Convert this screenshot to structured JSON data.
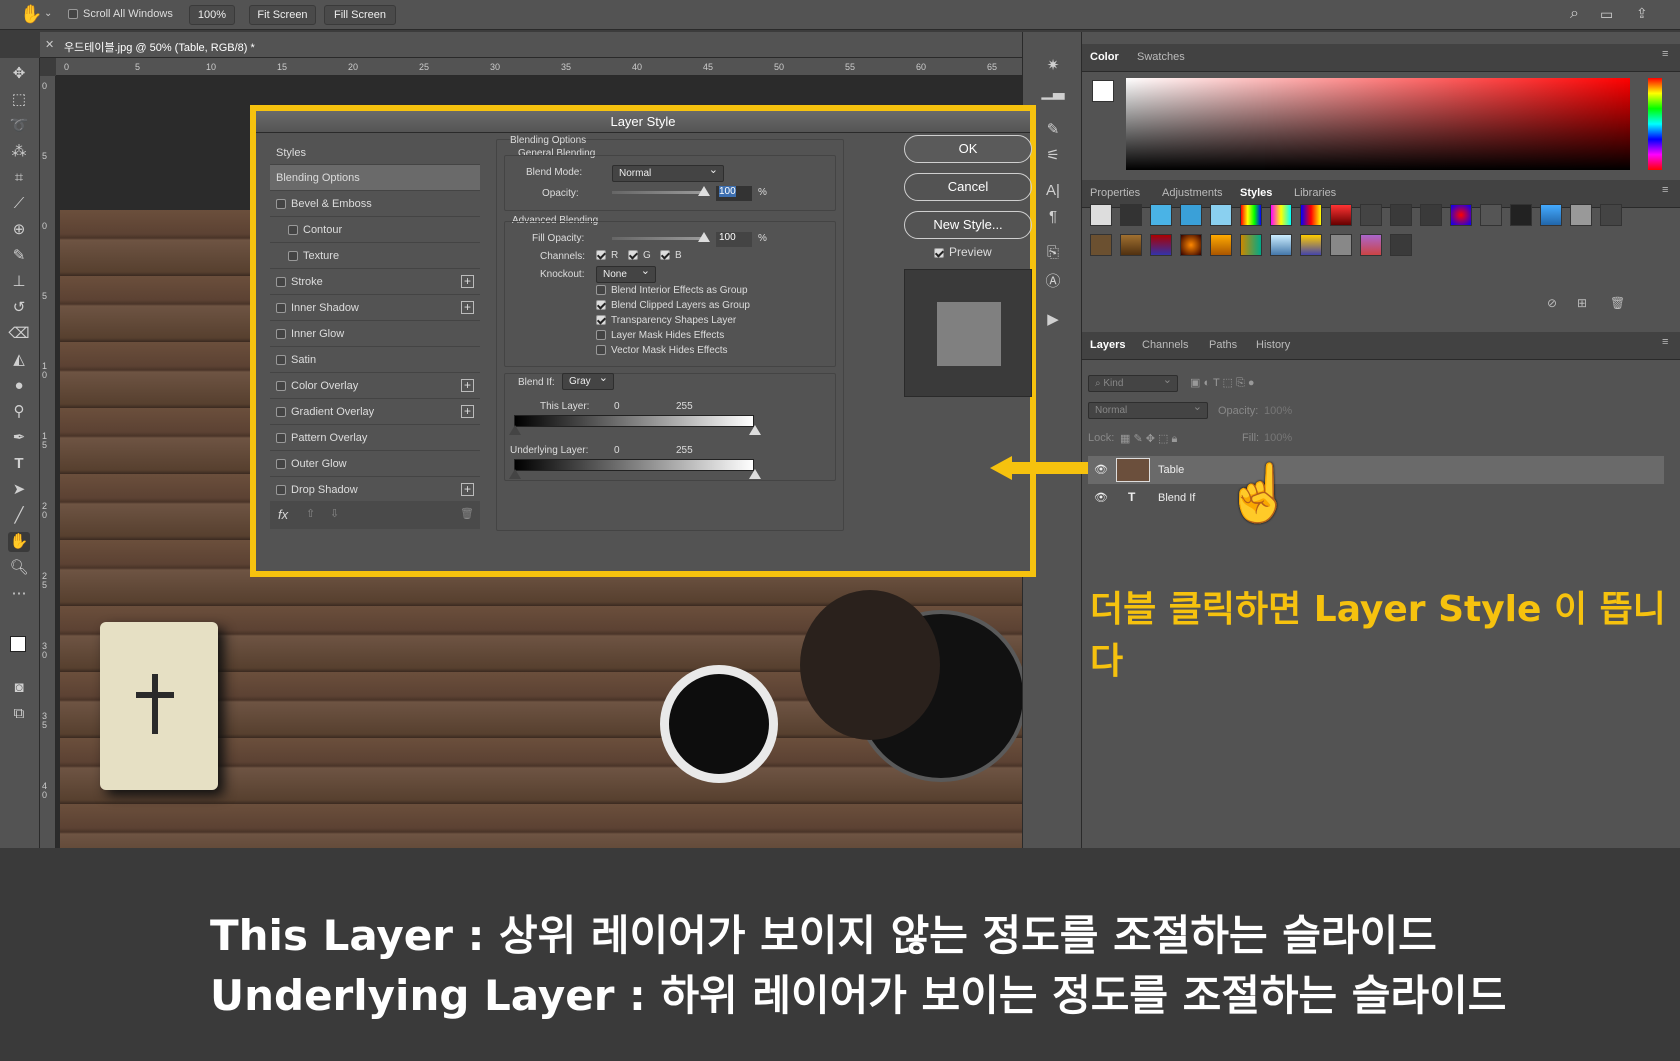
{
  "options_bar": {
    "scroll_all": "Scroll All Windows",
    "zoom": "100%",
    "fit": "Fit Screen",
    "fill": "Fill Screen"
  },
  "doc_tab": {
    "title": "우드테이블.jpg @ 50% (Table, RGB/8) *"
  },
  "ruler_h": [
    "0",
    "5",
    "10",
    "15",
    "20",
    "25",
    "30",
    "35",
    "40",
    "45",
    "50",
    "55",
    "60",
    "65"
  ],
  "ruler_v": [
    "0",
    "5",
    "0",
    "5",
    "1 0",
    "1 5",
    "2 0",
    "2 5",
    "3 0",
    "3 5",
    "4 0"
  ],
  "dialog": {
    "title": "Layer Style",
    "styles_header": "Styles",
    "styles": [
      {
        "label": "Blending Options",
        "checkbox": false,
        "plus": false,
        "selected": true,
        "indent": false
      },
      {
        "label": "Bevel & Emboss",
        "checkbox": true,
        "plus": false,
        "indent": false
      },
      {
        "label": "Contour",
        "checkbox": true,
        "plus": false,
        "indent": true
      },
      {
        "label": "Texture",
        "checkbox": true,
        "plus": false,
        "indent": true
      },
      {
        "label": "Stroke",
        "checkbox": true,
        "plus": true,
        "indent": false
      },
      {
        "label": "Inner Shadow",
        "checkbox": true,
        "plus": true,
        "indent": false
      },
      {
        "label": "Inner Glow",
        "checkbox": true,
        "plus": false,
        "indent": false
      },
      {
        "label": "Satin",
        "checkbox": true,
        "plus": false,
        "indent": false
      },
      {
        "label": "Color Overlay",
        "checkbox": true,
        "plus": true,
        "indent": false
      },
      {
        "label": "Gradient Overlay",
        "checkbox": true,
        "plus": true,
        "indent": false
      },
      {
        "label": "Pattern Overlay",
        "checkbox": true,
        "plus": false,
        "indent": false
      },
      {
        "label": "Outer Glow",
        "checkbox": true,
        "plus": false,
        "indent": false
      },
      {
        "label": "Drop Shadow",
        "checkbox": true,
        "plus": true,
        "indent": false
      }
    ],
    "fx": "fx",
    "blending_options": "Blending Options",
    "general_blending": "General Blending",
    "blend_mode_label": "Blend Mode:",
    "blend_mode": "Normal",
    "opacity_label": "Opacity:",
    "opacity": "100",
    "pct": "%",
    "advanced_blending": "Advanced Blending",
    "fill_opacity_label": "Fill Opacity:",
    "fill_opacity": "100",
    "channels_label": "Channels:",
    "ch_r": "R",
    "ch_g": "G",
    "ch_b": "B",
    "knockout_label": "Knockout:",
    "knockout": "None",
    "options": [
      {
        "label": "Blend Interior Effects as Group",
        "checked": false
      },
      {
        "label": "Blend Clipped Layers as Group",
        "checked": true
      },
      {
        "label": "Transparency Shapes Layer",
        "checked": true
      },
      {
        "label": "Layer Mask Hides Effects",
        "checked": false
      },
      {
        "label": "Vector Mask Hides Effects",
        "checked": false
      }
    ],
    "blend_if_label": "Blend If:",
    "blend_if": "Gray",
    "this_layer_label": "This Layer:",
    "this_min": "0",
    "this_max": "255",
    "underlying_label": "Underlying Layer:",
    "under_min": "0",
    "under_max": "255",
    "ok": "OK",
    "cancel": "Cancel",
    "new_style": "New Style...",
    "preview": "Preview"
  },
  "color_panel": {
    "tabs": [
      "Color",
      "Swatches"
    ]
  },
  "styles_panel": {
    "tabs": [
      "Properties",
      "Adjustments",
      "Styles",
      "Libraries"
    ],
    "active": "Styles"
  },
  "layers_panel": {
    "tabs": [
      "Layers",
      "Channels",
      "Paths",
      "History"
    ],
    "kind": "Kind",
    "mode": "Normal",
    "opacity_label": "Opacity:",
    "opacity": "100%",
    "lock_label": "Lock:",
    "fill_label": "Fill:",
    "fill": "100%",
    "layers": [
      {
        "name": "Table",
        "type": "image",
        "selected": true
      },
      {
        "name": "Blend If",
        "type": "text",
        "selected": false
      }
    ]
  },
  "annotations": {
    "callout": "더블 클릭하면 Layer Style 이 뜹니다",
    "line1": "This Layer : 상위 레이어가 보이지 않는 정도를 조절하는 슬라이드",
    "line2": "Underlying Layer : 하위 레이어가 보이는 정도를 조절하는 슬라이드",
    "accent": "#f6c20e"
  }
}
